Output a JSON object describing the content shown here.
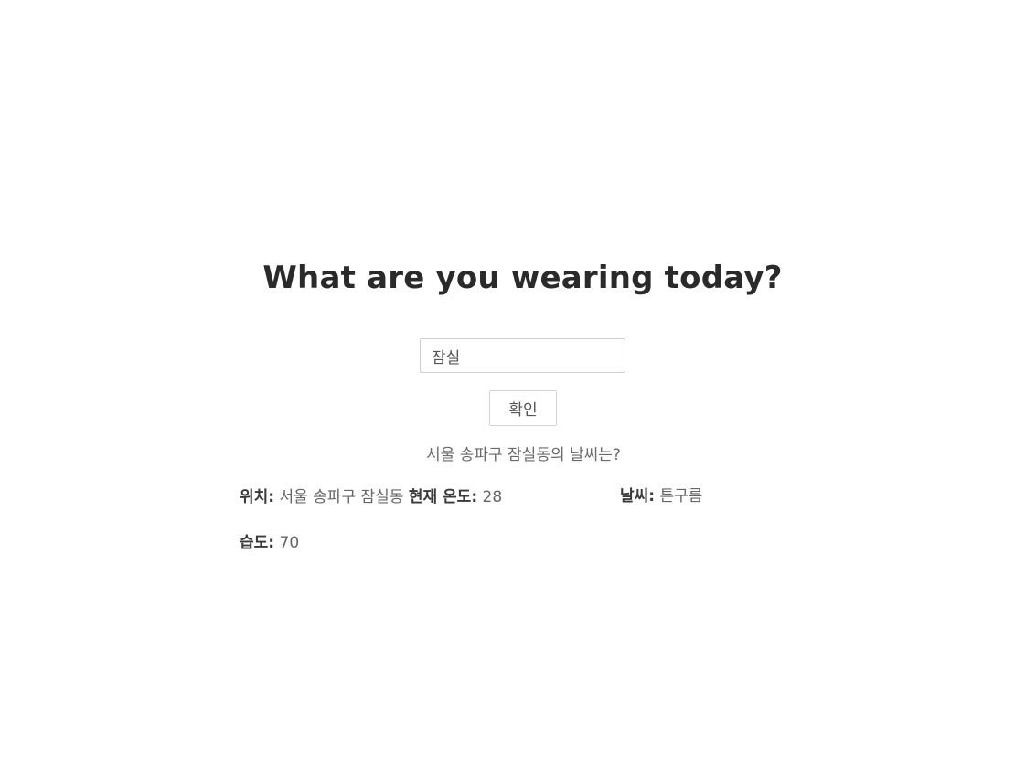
{
  "header": {
    "title": "What are you wearing today?"
  },
  "search": {
    "value": "잠실",
    "placeholder": ""
  },
  "actions": {
    "confirm_label": "확인"
  },
  "result": {
    "question": "서울 송파구 잠실동의 날씨는?",
    "location_label": "위치:",
    "location_value": "서울 송파구 잠실동",
    "temperature_label": "현재 온도:",
    "temperature_value": "28",
    "weather_label": "날씨:",
    "weather_value": "튼구름",
    "humidity_label": "습도:",
    "humidity_value": "70"
  }
}
